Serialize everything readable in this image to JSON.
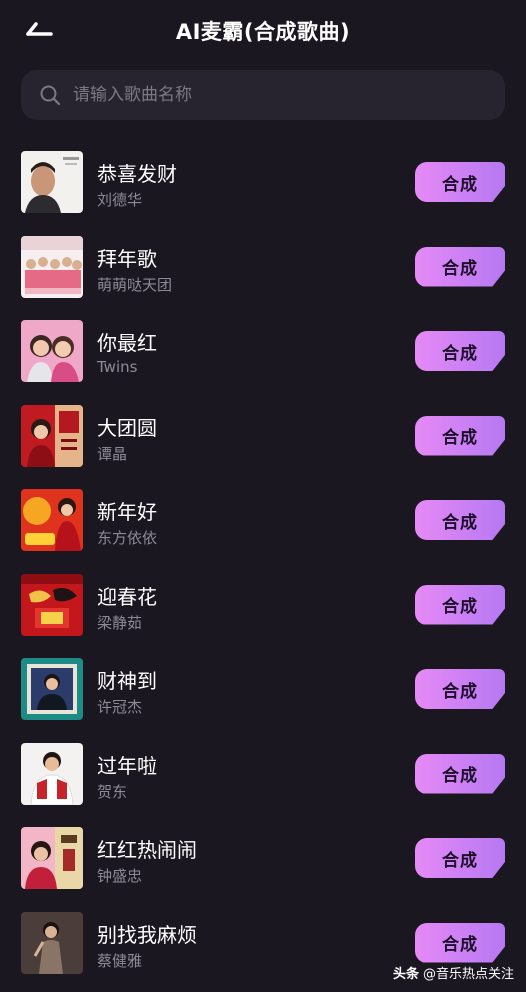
{
  "header": {
    "title": "AI麦霸(合成歌曲)",
    "back_icon": "back-arrow-icon"
  },
  "search": {
    "placeholder": "请输入歌曲名称",
    "value": "",
    "icon": "search-icon"
  },
  "colors": {
    "background": "#1a1721",
    "search_bg": "#27242f",
    "button_gradient_start": "#e68af6",
    "button_gradient_end": "#b678f2",
    "artist_text": "#8d8a96"
  },
  "songs": [
    {
      "title": "恭喜发财",
      "artist": "刘德华",
      "button": "合成"
    },
    {
      "title": "拜年歌",
      "artist": "萌萌哒天团",
      "button": "合成"
    },
    {
      "title": "你最红",
      "artist": "Twins",
      "button": "合成"
    },
    {
      "title": "大团圆",
      "artist": "谭晶",
      "button": "合成"
    },
    {
      "title": "新年好",
      "artist": "东方依依",
      "button": "合成"
    },
    {
      "title": "迎春花",
      "artist": "梁静茹",
      "button": "合成"
    },
    {
      "title": "财神到",
      "artist": "许冠杰",
      "button": "合成"
    },
    {
      "title": "过年啦",
      "artist": "贺东",
      "button": "合成"
    },
    {
      "title": "红红热闹闹",
      "artist": "钟盛忠",
      "button": "合成"
    },
    {
      "title": "别找我麻烦",
      "artist": "蔡健雅",
      "button": "合成"
    }
  ],
  "watermark": {
    "brand": "头条",
    "handle": "@音乐热点关注"
  }
}
